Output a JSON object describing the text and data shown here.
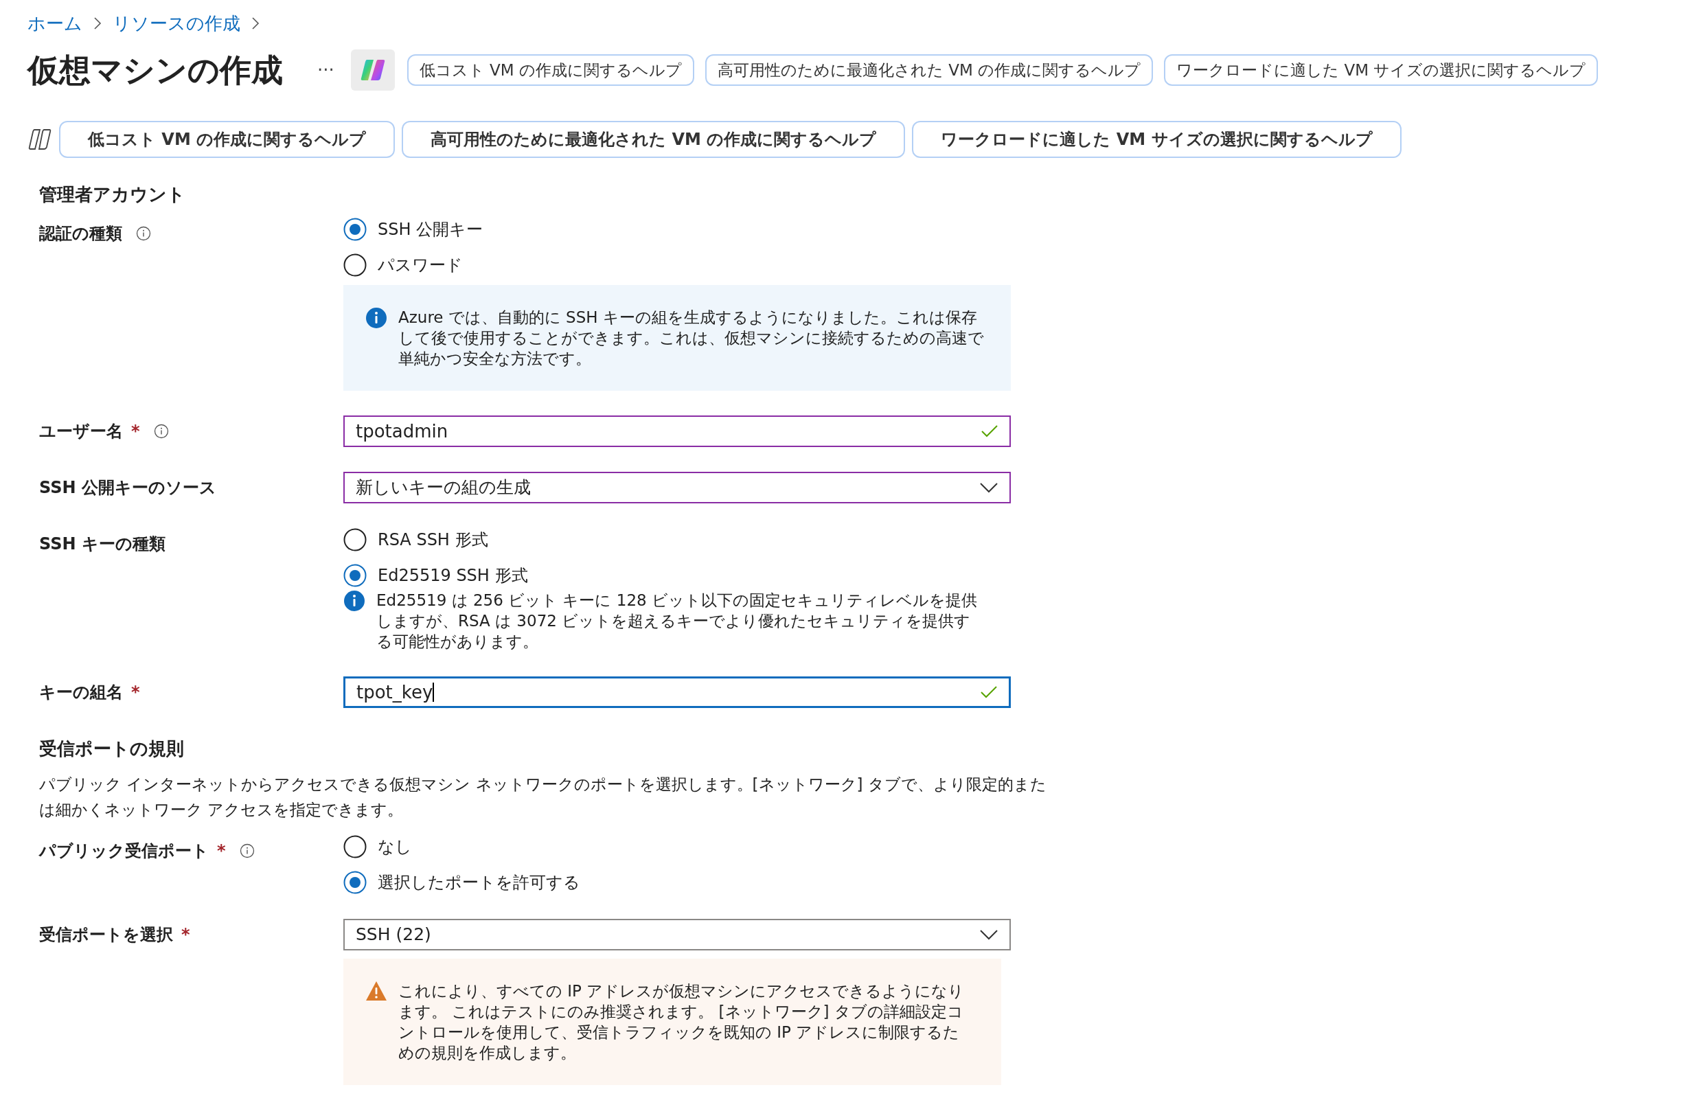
{
  "breadcrumb": [
    "ホーム",
    "リソースの作成"
  ],
  "title": "仮想マシンの作成",
  "more_button": "···",
  "header_help_buttons": [
    "低コスト VM の作成に関するヘルプ",
    "高可用性のために最適化された VM の作成に関するヘルプ",
    "ワークロードに適した VM サイズの選択に関するヘルプ"
  ],
  "copilot_help_buttons": [
    "低コスト VM の作成に関するヘルプ",
    "高可用性のために最適化された VM の作成に関するヘルプ",
    "ワークロードに適した VM サイズの選択に関するヘルプ"
  ],
  "sections": [
    {
      "heading": "管理者アカウント",
      "fields": [
        {
          "kind": "radio",
          "label": "認証の種類",
          "info": true,
          "options": [
            {
              "label": "SSH 公開キー",
              "selected": true
            },
            {
              "label": "パスワード",
              "selected": false
            }
          ],
          "note": {
            "kind": "info_box",
            "text": "Azure では、自動的に SSH キーの組を生成するようになりました。これは保存して後で使用することができます。これは、仮想マシンに接続するための高速で単純かつ安全な方法です。"
          }
        },
        {
          "kind": "text",
          "label": "ユーザー名",
          "required_mark": "*",
          "info": true,
          "value": "tpotadmin",
          "edited": true,
          "focused": false,
          "valid": true
        },
        {
          "kind": "select",
          "label": "SSH 公開キーのソース",
          "info": false,
          "value": "新しいキーの組の生成",
          "edited": true
        },
        {
          "kind": "radio",
          "label": "SSH キーの種類",
          "info": false,
          "options": [
            {
              "label": "RSA SSH 形式",
              "selected": false
            },
            {
              "label": "Ed25519 SSH 形式",
              "selected": true
            }
          ],
          "note": {
            "kind": "info_inline",
            "text": "Ed25519 は 256 ビット キーに 128 ビット以下の固定セキュリティレベルを提供しますが、RSA は 3072 ビットを超えるキーでより優れたセキュリティを提供する可能性があります。"
          }
        },
        {
          "kind": "text",
          "label": "キーの組名",
          "required_mark": "*",
          "info": false,
          "value": "tpot_key",
          "focused": true,
          "valid": true
        }
      ]
    },
    {
      "heading": "受信ポートの規則",
      "description": "パブリック インターネットからアクセスできる仮想マシン ネットワークのポートを選択します。[ネットワーク] タブで、より限定的または細かくネットワーク アクセスを指定できます。",
      "fields": [
        {
          "kind": "radio",
          "label": "パブリック受信ポート",
          "required_mark": "*",
          "info": true,
          "options": [
            {
              "label": "なし",
              "selected": false
            },
            {
              "label": "選択したポートを許可する",
              "selected": true
            }
          ]
        },
        {
          "kind": "select",
          "label": "受信ポートを選択",
          "required_mark": "*",
          "info": false,
          "value": "SSH (22)",
          "edited": false,
          "note": {
            "kind": "warning_box",
            "text": "これにより、すべての IP アドレスが仮想マシンにアクセスできるようになります。 これはテストにのみ推奨されます。 [ネットワーク] タブの詳細設定コントロールを使用して、受信トラフィックを既知の IP アドレスに制限するための規則を作成します。"
          }
        }
      ]
    }
  ]
}
